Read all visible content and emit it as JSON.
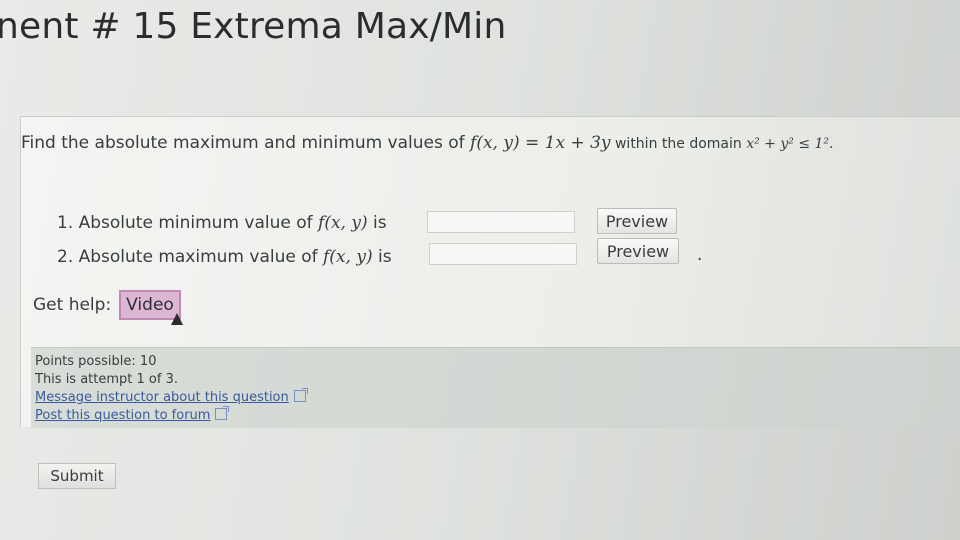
{
  "header": {
    "title": "nent # 15 Extrema Max/Min"
  },
  "question": {
    "prefix": "Find the absolute maximum and minimum values of ",
    "func": "f(x, y) = 1x + 3y",
    "mid": " within the domain ",
    "domain": "x² + y² ≤ 1²."
  },
  "parts": [
    {
      "label": "1. Absolute minimum value of ",
      "func": "f(x, y)",
      "suffix": " is",
      "value": "",
      "preview_label": "Preview"
    },
    {
      "label": "2. Absolute maximum value of ",
      "func": "f(x, y)",
      "suffix": " is",
      "value": "",
      "preview_label": "Preview"
    }
  ],
  "trailing_dot": ".",
  "help": {
    "label": "Get help:",
    "video_label": "Video"
  },
  "info": {
    "points": "Points possible: 10",
    "attempt": "This is attempt 1 of 3.",
    "message_link": "Message instructor about this question",
    "forum_link": "Post this question to forum"
  },
  "submit_label": "Submit"
}
